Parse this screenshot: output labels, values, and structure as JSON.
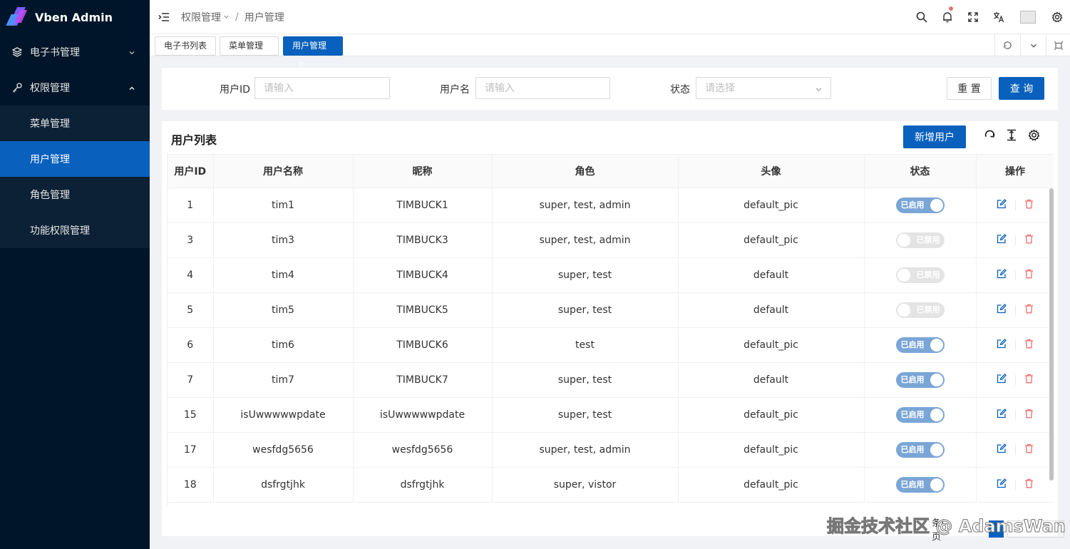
{
  "app": {
    "title": "Vben Admin"
  },
  "colors": {
    "primary": "#0960bd",
    "sidebar": "#001529",
    "danger": "#ed6f6f"
  },
  "sidebar": {
    "items": [
      {
        "label": "电子书管理",
        "icon": "layers-icon",
        "expanded": false
      },
      {
        "label": "权限管理",
        "icon": "key-icon",
        "expanded": true
      }
    ],
    "submenu": [
      {
        "label": "菜单管理",
        "active": false
      },
      {
        "label": "用户管理",
        "active": true
      },
      {
        "label": "角色管理",
        "active": false
      },
      {
        "label": "功能权限管理",
        "active": false
      }
    ]
  },
  "header": {
    "breadcrumb": [
      "权限管理",
      "用户管理"
    ],
    "icons": [
      "search-icon",
      "bell-icon",
      "fullscreen-icon",
      "translate-icon",
      "avatar",
      "gear-icon"
    ]
  },
  "tabs": [
    {
      "label": "电子书列表",
      "active": false
    },
    {
      "label": "菜单管理",
      "active": false
    },
    {
      "label": "用户管理",
      "active": true,
      "close": "×"
    }
  ],
  "search": {
    "fields": [
      {
        "label": "用户ID",
        "placeholder": "请输入"
      },
      {
        "label": "用户名",
        "placeholder": "请输入"
      },
      {
        "label": "状态",
        "placeholder": "请选择"
      }
    ],
    "reset_label": "重 置",
    "query_label": "查 询"
  },
  "table": {
    "title": "用户列表",
    "add_label": "新增用户",
    "columns": [
      "用户ID",
      "用户名称",
      "昵称",
      "角色",
      "头像",
      "状态",
      "操作"
    ],
    "rows": [
      {
        "id": "1",
        "name": "tim1",
        "nick": "TIMBUCK1",
        "roles": "super, test, admin",
        "avatar": "default_pic",
        "enabled": true
      },
      {
        "id": "3",
        "name": "tim3",
        "nick": "TIMBUCK3",
        "roles": "super, test, admin",
        "avatar": "default_pic",
        "enabled": false
      },
      {
        "id": "4",
        "name": "tim4",
        "nick": "TIMBUCK4",
        "roles": "super, test",
        "avatar": "default",
        "enabled": false
      },
      {
        "id": "5",
        "name": "tim5",
        "nick": "TIMBUCK5",
        "roles": "super, test",
        "avatar": "default",
        "enabled": false
      },
      {
        "id": "6",
        "name": "tim6",
        "nick": "TIMBUCK6",
        "roles": "test",
        "avatar": "default_pic",
        "enabled": true
      },
      {
        "id": "7",
        "name": "tim7",
        "nick": "TIMBUCK7",
        "roles": "super, test",
        "avatar": "default",
        "enabled": true
      },
      {
        "id": "15",
        "name": "isUwwwwwpdate",
        "nick": "isUwwwwwpdate",
        "roles": "super, test",
        "avatar": "default_pic",
        "enabled": true
      },
      {
        "id": "17",
        "name": "wesfdg5656",
        "nick": "wesfdg5656",
        "roles": "super, test, admin",
        "avatar": "default_pic",
        "enabled": true
      },
      {
        "id": "18",
        "name": "dsfrgtjhk",
        "nick": "dsfrgtjhk",
        "roles": "super, vistor",
        "avatar": "default_pic",
        "enabled": true
      }
    ],
    "switch_on_label": "已启用",
    "switch_off_label": "已禁用"
  },
  "pagination": {
    "page_size_text": "条/页"
  },
  "watermark": "掘金技术社区 @ AdamsWan"
}
